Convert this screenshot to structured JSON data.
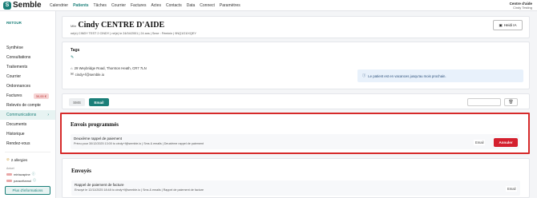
{
  "app": {
    "name": "Semble",
    "logo_letter": "S"
  },
  "nav": [
    "Calendrier",
    "Patients",
    "Tâches",
    "Courrier",
    "Factures",
    "Actes",
    "Contacts",
    "Data",
    "Connect",
    "Paramètres"
  ],
  "nav_active": "Patients",
  "user": {
    "org": "Centre d'aide",
    "name": "Cindy Testing"
  },
  "sidebar": {
    "back": "RETOUR",
    "items": [
      {
        "label": "Synthèse"
      },
      {
        "label": "Consultations"
      },
      {
        "label": "Traitements"
      },
      {
        "label": "Courrier"
      },
      {
        "label": "Ordonnances"
      },
      {
        "label": "Factures",
        "badge": "30,00 €"
      },
      {
        "label": "Relevés de compte"
      },
      {
        "label": "Communications",
        "active": true
      },
      {
        "label": "Documents"
      },
      {
        "label": "Historique"
      },
      {
        "label": "Rendez-vous"
      }
    ],
    "allergies": "2 allergies",
    "treatments_title": "Actuel",
    "treatments": [
      {
        "name": "mirtazapine",
        "color": "#e9a6a6"
      },
      {
        "name": "paracétamol",
        "color": "#e9a6a6"
      }
    ],
    "more_button": "Plus d'informations"
  },
  "patient": {
    "prefix": "Mlle",
    "name": "Cindy CENTRE D'AIDE",
    "subline": "né(e) CINDY TEST 2 CINDY  |  né(e) le 24/04/2001  |  24 ans  |  Sexe : Féminin  |  9NQ1G1IXQEY",
    "heidi_label": "Heidi IA"
  },
  "info": {
    "tags_label": "Tags",
    "address": "29 Weybridge Road, Thornton Heath, CR7 7LN",
    "email": "cindy+f@semble.io",
    "vacation_notice": "Le patient est en vacances jusqu'au mois prochain."
  },
  "tabs": {
    "sms": "SMS",
    "email": "Email"
  },
  "scheduled": {
    "title": "Envois programmés",
    "item": {
      "title": "Deuxième rappel de paiement",
      "sub": "Prévu pour 30/12/2025 13:00 to cindy+f@semble.io | Sms & emails | Deuxième rappel de paiement",
      "type": "Email",
      "cancel": "Annuler"
    }
  },
  "sent": {
    "title": "Envoyés",
    "item": {
      "title": "Rappel de paiement de facture",
      "sub": "Envoyé le 12/11/2025 18:48 to cindy+f@semble.io | Sms & emails | Rappel de paiement de facture",
      "type": "Email"
    }
  },
  "colors": {
    "brand": "#1b7f79",
    "danger": "#d4202e",
    "highlight_border": "#d62a2a"
  }
}
